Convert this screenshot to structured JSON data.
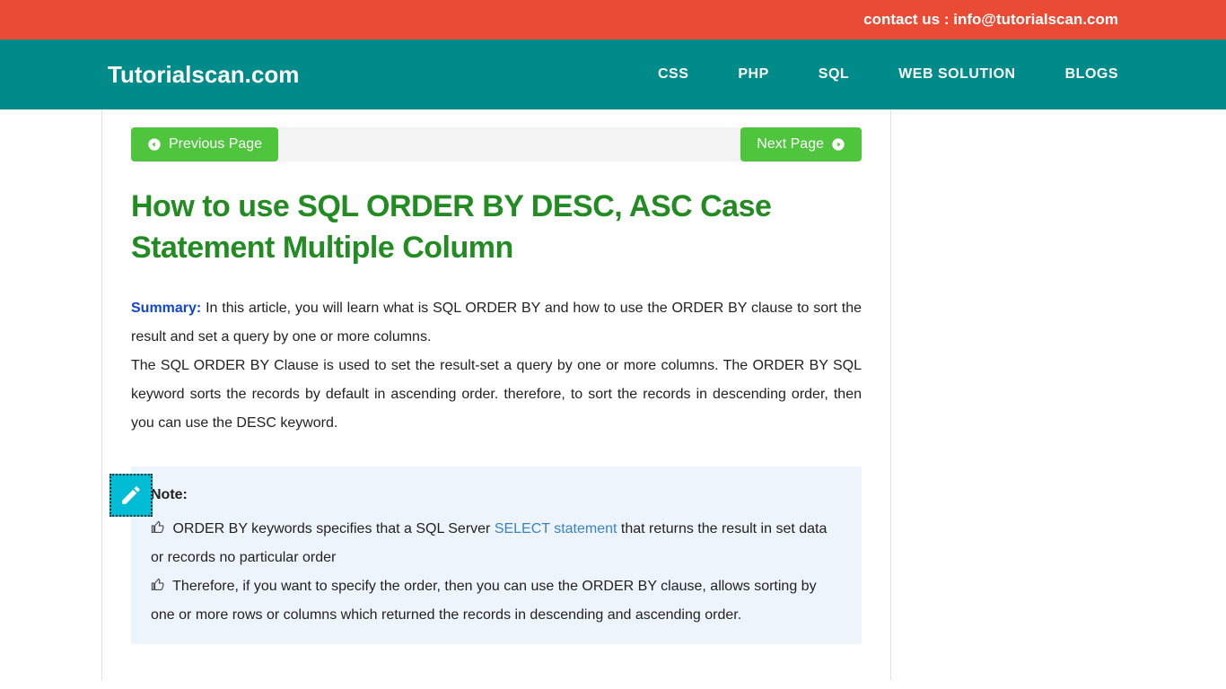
{
  "topbar": {
    "contact": "contact us : info@tutorialscan.com"
  },
  "nav": {
    "logo": "Tutorialscan.com",
    "links": [
      "CSS",
      "PHP",
      "SQL",
      "WEB SOLUTION",
      "BLOGS"
    ]
  },
  "pager": {
    "prev": "Previous Page",
    "next": "Next Page"
  },
  "article": {
    "title": "How to use SQL ORDER BY DESC, ASC Case Statement Multiple Column",
    "summary_label": "Summary:",
    "summary_text": " In this article, you will learn what is SQL ORDER BY and how to use the ORDER BY clause to sort the result and set a query by one or more columns.",
    "intro_text": "The SQL ORDER BY Clause is used to set the result-set a query by one or more columns. The ORDER BY SQL keyword sorts the records by default in ascending order. therefore, to sort the records in descending order, then you can use the DESC keyword."
  },
  "note": {
    "heading": "Note:",
    "point1_a": "ORDER BY keywords specifies that a SQL Server ",
    "point1_link": "SELECT statement",
    "point1_b": " that returns the result in set data or records no particular order",
    "point2": "Therefore, if you want to specify the order, then you can use the ORDER BY clause, allows sorting by one or more rows or columns which returned the records in descending and ascending order."
  }
}
